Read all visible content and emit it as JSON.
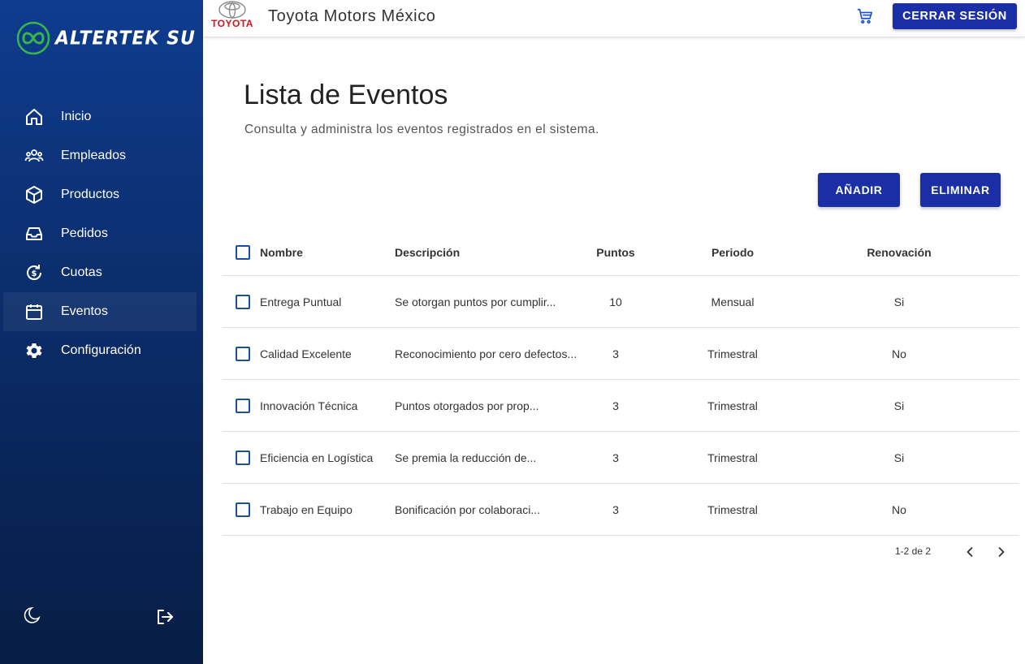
{
  "sidebar": {
    "brand": "ALTERTEK SU",
    "items": [
      {
        "label": "Inicio",
        "icon": "home-icon"
      },
      {
        "label": "Empleados",
        "icon": "users-icon"
      },
      {
        "label": "Productos",
        "icon": "box-icon"
      },
      {
        "label": "Pedidos",
        "icon": "inbox-icon"
      },
      {
        "label": "Cuotas",
        "icon": "money-cycle-icon"
      },
      {
        "label": "Eventos",
        "icon": "calendar-icon",
        "active": true
      },
      {
        "label": "Configuración",
        "icon": "gear-icon"
      }
    ],
    "bottom": {
      "left_icon": "moon-icon",
      "right_icon": "logout-icon"
    }
  },
  "topbar": {
    "logo_text": "TOYOTA",
    "company": "Toyota Motors México",
    "cart_icon": "cart-icon",
    "logout_label": "CERRAR SESIÓN"
  },
  "main": {
    "title": "Lista de Eventos",
    "subtitle": "Consulta y administra los eventos registrados en el sistema.",
    "add_label": "AÑADIR",
    "delete_label": "ELIMINAR"
  },
  "table": {
    "headers": {
      "name": "Nombre",
      "desc": "Descripción",
      "points": "Puntos",
      "period": "Periodo",
      "renewal": "Renovación"
    },
    "rows": [
      {
        "name": "Entrega Puntual",
        "desc": "Se otorgan puntos por cumplir...",
        "points": "10",
        "period": "Mensual",
        "renewal": "Si"
      },
      {
        "name": "Calidad Excelente",
        "desc": "Reconocimiento por cero defectos...",
        "points": "3",
        "period": "Trimestral",
        "renewal": "No"
      },
      {
        "name": "Innovación Técnica",
        "desc": "Puntos otorgados por prop...",
        "points": "3",
        "period": "Trimestral",
        "renewal": "Si"
      },
      {
        "name": "Eficiencia en Logística",
        "desc": "Se premia la reducción de...",
        "points": "3",
        "period": "Trimestral",
        "renewal": "Si"
      },
      {
        "name": "Trabajo en Equipo",
        "desc": "Bonificación por colaboraci...",
        "points": "3",
        "period": "Trimestral",
        "renewal": "No"
      }
    ]
  },
  "pagination": {
    "label": "1-2 de 2"
  },
  "colors": {
    "primary": "#1a2fa6",
    "sidebar_top": "#0f3c8f",
    "sidebar_bottom": "#071d45",
    "checkbox": "#1a4fa3",
    "toyota_red": "#d0121b"
  }
}
